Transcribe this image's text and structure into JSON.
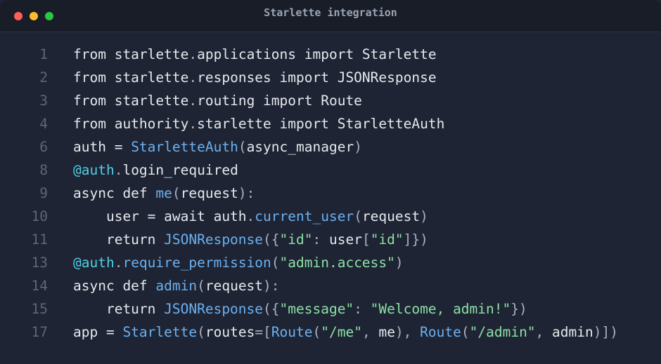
{
  "window": {
    "title": "Starlette integration",
    "controls": [
      {
        "name": "close",
        "color": "#ff5f57"
      },
      {
        "name": "minimize",
        "color": "#febc2e"
      },
      {
        "name": "maximize",
        "color": "#28c840"
      }
    ]
  },
  "colors": {
    "background": "#1e2433",
    "titlebar": "#181d28",
    "plain": "#e6e8ee",
    "function": "#6cb0f0",
    "decorator": "#4fd0e3",
    "string": "#8ce0a6",
    "line_number": "#5d6678"
  },
  "code": {
    "lines": [
      {
        "n": "1",
        "tokens": [
          {
            "t": "from starlette",
            "k": "plain"
          },
          {
            "t": ".",
            "k": "punct"
          },
          {
            "t": "applications import Starlette",
            "k": "plain"
          }
        ]
      },
      {
        "n": "2",
        "tokens": [
          {
            "t": "from starlette",
            "k": "plain"
          },
          {
            "t": ".",
            "k": "punct"
          },
          {
            "t": "responses import JSONResponse",
            "k": "plain"
          }
        ]
      },
      {
        "n": "3",
        "tokens": [
          {
            "t": "from starlette",
            "k": "plain"
          },
          {
            "t": ".",
            "k": "punct"
          },
          {
            "t": "routing import Route",
            "k": "plain"
          }
        ]
      },
      {
        "n": "4",
        "tokens": [
          {
            "t": "from authority",
            "k": "plain"
          },
          {
            "t": ".",
            "k": "punct"
          },
          {
            "t": "starlette import StarletteAuth",
            "k": "plain"
          }
        ]
      },
      {
        "n": "6",
        "tokens": [
          {
            "t": "auth = ",
            "k": "plain"
          },
          {
            "t": "StarletteAuth",
            "k": "fn"
          },
          {
            "t": "(",
            "k": "punct"
          },
          {
            "t": "async_manager",
            "k": "plain"
          },
          {
            "t": ")",
            "k": "punct"
          }
        ]
      },
      {
        "n": "8",
        "tokens": [
          {
            "t": "@auth",
            "k": "deco"
          },
          {
            "t": ".",
            "k": "punct"
          },
          {
            "t": "login_required",
            "k": "plain"
          }
        ]
      },
      {
        "n": "9",
        "tokens": [
          {
            "t": "async def ",
            "k": "plain"
          },
          {
            "t": "me",
            "k": "fn"
          },
          {
            "t": "(",
            "k": "punct"
          },
          {
            "t": "request",
            "k": "plain"
          },
          {
            "t": "):",
            "k": "punct"
          }
        ]
      },
      {
        "n": "10",
        "tokens": [
          {
            "t": "    user = await auth",
            "k": "plain"
          },
          {
            "t": ".",
            "k": "punct"
          },
          {
            "t": "current_user",
            "k": "fn"
          },
          {
            "t": "(",
            "k": "punct"
          },
          {
            "t": "request",
            "k": "plain"
          },
          {
            "t": ")",
            "k": "punct"
          }
        ]
      },
      {
        "n": "11",
        "tokens": [
          {
            "t": "    return ",
            "k": "plain"
          },
          {
            "t": "JSONResponse",
            "k": "fn"
          },
          {
            "t": "({",
            "k": "punct"
          },
          {
            "t": "\"id\"",
            "k": "str"
          },
          {
            "t": ": ",
            "k": "punct"
          },
          {
            "t": "user",
            "k": "plain"
          },
          {
            "t": "[",
            "k": "punct"
          },
          {
            "t": "\"id\"",
            "k": "str"
          },
          {
            "t": "]})",
            "k": "punct"
          }
        ]
      },
      {
        "n": "13",
        "tokens": [
          {
            "t": "@auth",
            "k": "deco"
          },
          {
            "t": ".",
            "k": "punct"
          },
          {
            "t": "require_permission",
            "k": "fn"
          },
          {
            "t": "(",
            "k": "punct"
          },
          {
            "t": "\"admin.access\"",
            "k": "str"
          },
          {
            "t": ")",
            "k": "punct"
          }
        ]
      },
      {
        "n": "14",
        "tokens": [
          {
            "t": "async def ",
            "k": "plain"
          },
          {
            "t": "admin",
            "k": "fn"
          },
          {
            "t": "(",
            "k": "punct"
          },
          {
            "t": "request",
            "k": "plain"
          },
          {
            "t": "):",
            "k": "punct"
          }
        ]
      },
      {
        "n": "15",
        "tokens": [
          {
            "t": "    return ",
            "k": "plain"
          },
          {
            "t": "JSONResponse",
            "k": "fn"
          },
          {
            "t": "({",
            "k": "punct"
          },
          {
            "t": "\"message\"",
            "k": "str"
          },
          {
            "t": ": ",
            "k": "punct"
          },
          {
            "t": "\"Welcome, admin!\"",
            "k": "str"
          },
          {
            "t": "})",
            "k": "punct"
          }
        ]
      },
      {
        "n": "17",
        "tokens": [
          {
            "t": "app = ",
            "k": "plain"
          },
          {
            "t": "Starlette",
            "k": "fn"
          },
          {
            "t": "(",
            "k": "punct"
          },
          {
            "t": "routes",
            "k": "plain"
          },
          {
            "t": "=[",
            "k": "punct"
          },
          {
            "t": "Route",
            "k": "fn"
          },
          {
            "t": "(",
            "k": "punct"
          },
          {
            "t": "\"/me\"",
            "k": "str"
          },
          {
            "t": ", ",
            "k": "punct"
          },
          {
            "t": "me",
            "k": "plain"
          },
          {
            "t": "), ",
            "k": "punct"
          },
          {
            "t": "Route",
            "k": "fn"
          },
          {
            "t": "(",
            "k": "punct"
          },
          {
            "t": "\"/admin\"",
            "k": "str"
          },
          {
            "t": ", ",
            "k": "punct"
          },
          {
            "t": "admin",
            "k": "plain"
          },
          {
            "t": ")])",
            "k": "punct"
          }
        ]
      }
    ]
  }
}
